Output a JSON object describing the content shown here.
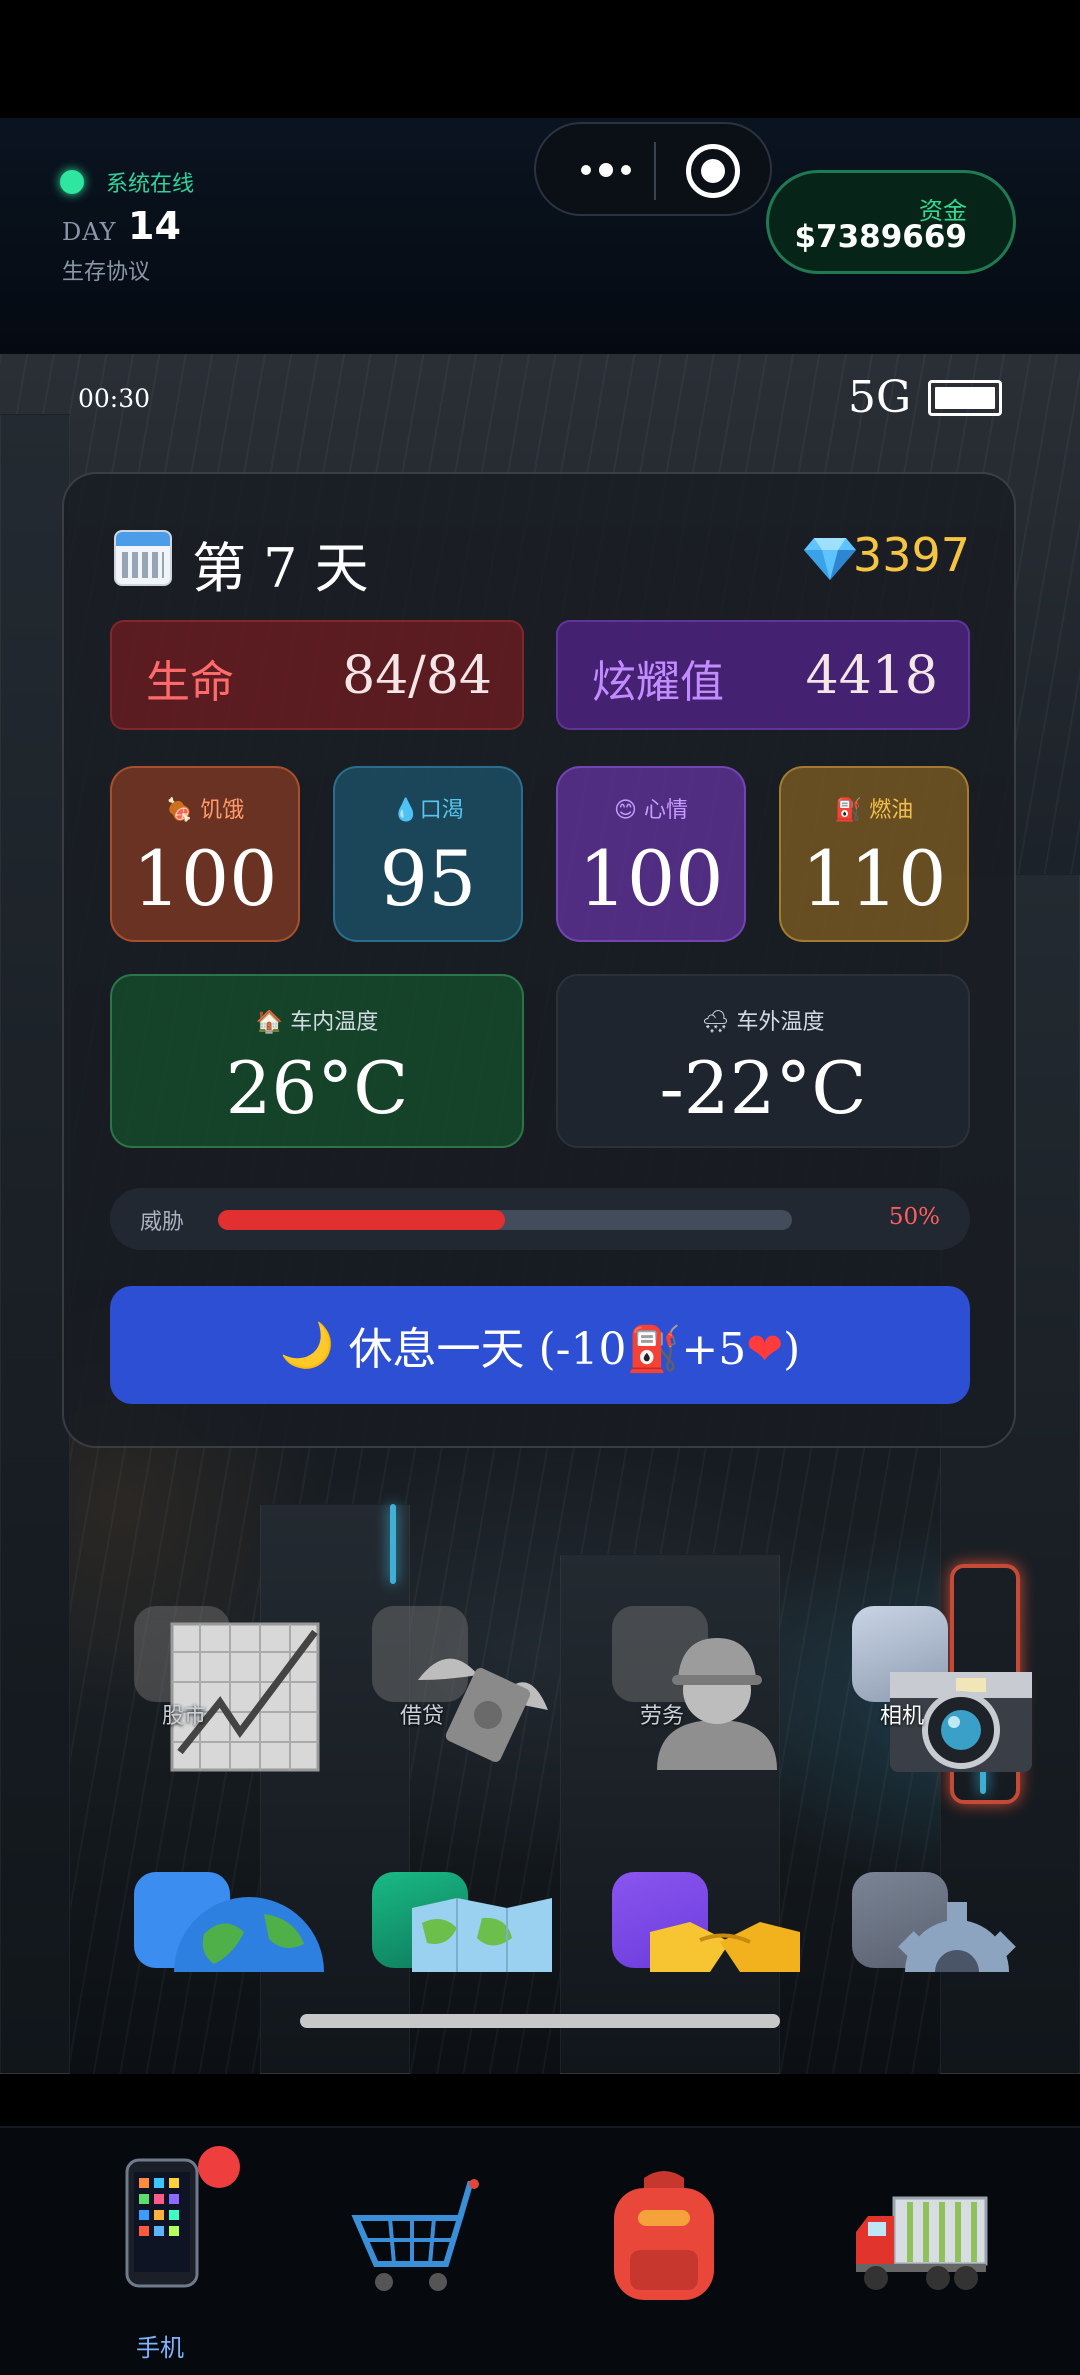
{
  "header": {
    "status_text": "系统在线",
    "day_label": "DAY",
    "day_number": "14",
    "protocol_text": "生存协议",
    "funds_label": "资金",
    "funds_value": "$7389669"
  },
  "phone_status": {
    "time": "00:30",
    "signal": "5G",
    "battery_level": 1.0
  },
  "panel": {
    "day_title": "第 7 天",
    "diamonds": "3397",
    "life": {
      "label": "生命",
      "value": "84/84"
    },
    "glory": {
      "label": "炫耀值",
      "value": "4418"
    },
    "gauges": [
      {
        "label": "饥饿",
        "value": "100",
        "icon": "meat-icon"
      },
      {
        "label": "口渴",
        "value": "95",
        "icon": "droplet-icon"
      },
      {
        "label": "心情",
        "value": "100",
        "icon": "smile-icon"
      },
      {
        "label": "燃油",
        "value": "110",
        "icon": "fuel-pump-icon"
      }
    ],
    "temp_inside": {
      "label": "车内温度",
      "value": "26°C",
      "icon": "house-icon"
    },
    "temp_outside": {
      "label": "车外温度",
      "value": "-22°C",
      "icon": "snow-cloud-icon"
    },
    "threat": {
      "label": "威胁",
      "percent_text": "50%",
      "level": 0.5
    },
    "rest_button": {
      "part1": "休息一天 (-10",
      "part2": "+5",
      "part3": ")"
    }
  },
  "apps": [
    {
      "label": "股市",
      "icon": "chart-increasing-icon"
    },
    {
      "label": "借贷",
      "icon": "money-with-wings-icon"
    },
    {
      "label": "劳务",
      "icon": "construction-worker-icon"
    },
    {
      "label": "相机",
      "icon": "camera-icon"
    },
    {
      "label": "",
      "icon": "globe-icon"
    },
    {
      "label": "",
      "icon": "world-map-icon"
    },
    {
      "label": "",
      "icon": "handshake-icon"
    },
    {
      "label": "",
      "icon": "gear-icon"
    }
  ],
  "nav": [
    {
      "label": "手机",
      "icon": "mobile-phone-icon",
      "active": true
    },
    {
      "label": "",
      "icon": "shopping-cart-icon"
    },
    {
      "label": "",
      "icon": "backpack-icon"
    },
    {
      "label": "",
      "icon": "truck-icon"
    }
  ],
  "colors": {
    "online": "#2ee6a0",
    "funds_border": "#1f7a52",
    "diamond": "#f5c542",
    "rest_button": "#2d4fd3",
    "threat_fill": "#e23030",
    "active_nav": "#7fb2ff"
  }
}
